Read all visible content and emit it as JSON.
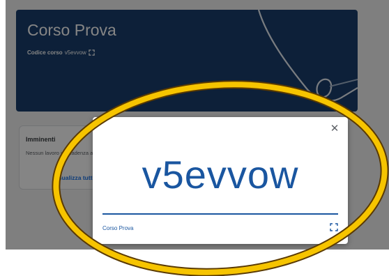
{
  "course": {
    "title": "Corso Prova",
    "code_label": "Codice corso",
    "code": "v5evvow"
  },
  "upcoming": {
    "heading": "Imminenti",
    "text": "Nessun lavoro in scadenza a breve",
    "view_all": "Visualizza tutto"
  },
  "dialog": {
    "code": "v5evvow",
    "course_name": "Corso Prova",
    "close_icon": "close-icon",
    "expand_icon": "fullscreen-icon"
  },
  "colors": {
    "banner": "#1a3f6d",
    "accent": "#1a56a0",
    "highlight": "#f6c400"
  }
}
